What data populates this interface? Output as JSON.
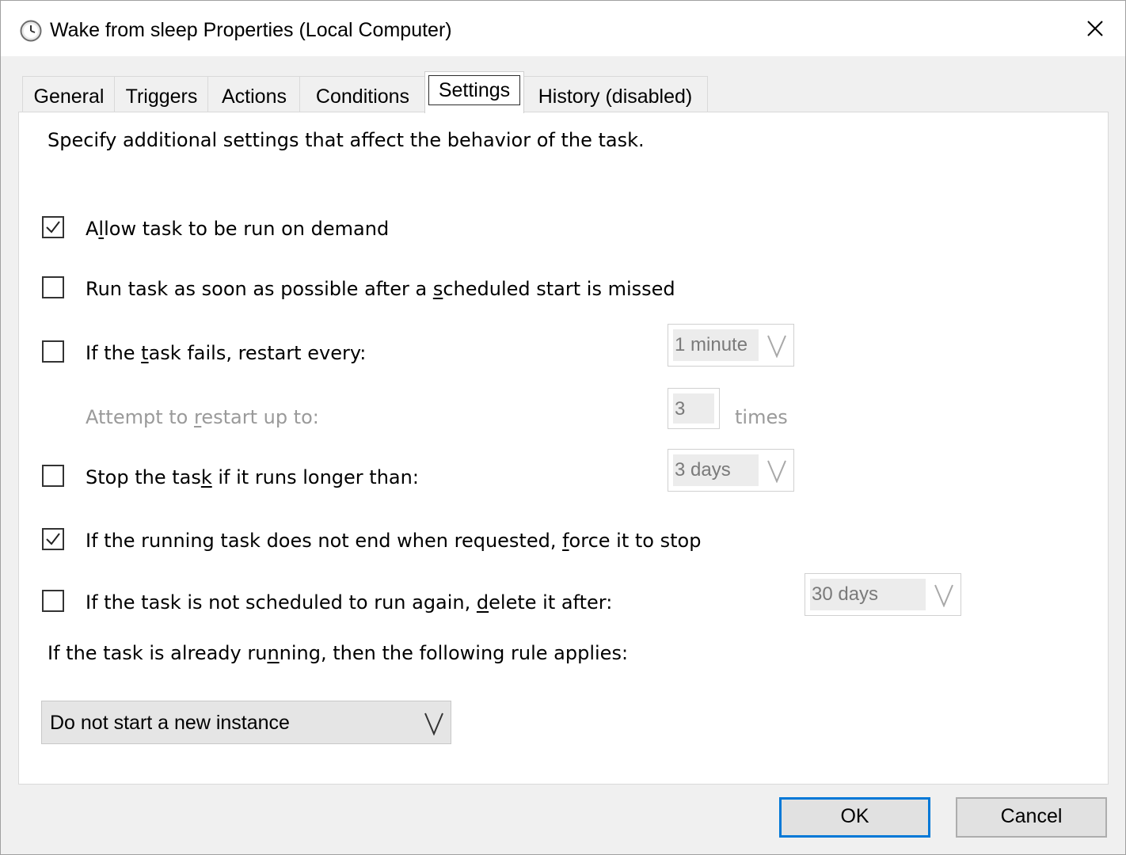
{
  "window": {
    "title": "Wake from sleep Properties (Local Computer)",
    "title_icon": "clock-icon",
    "close_icon": "close-icon"
  },
  "tabs": [
    {
      "label": "General",
      "active": false
    },
    {
      "label": "Triggers",
      "active": false
    },
    {
      "label": "Actions",
      "active": false
    },
    {
      "label": "Conditions",
      "active": false
    },
    {
      "label": "Settings",
      "active": true
    },
    {
      "label": "History (disabled)",
      "active": false
    }
  ],
  "settings": {
    "description": "Specify additional settings that affect the behavior of the task.",
    "allow_on_demand": {
      "label_pre": "A",
      "label_u": "l",
      "label_post": "low task to be run on demand",
      "checked": true
    },
    "run_asap": {
      "label_pre": "Run task as soon as possible after a ",
      "label_u": "s",
      "label_post": "cheduled start is missed",
      "checked": false
    },
    "restart_on_fail": {
      "label_pre": "If the ",
      "label_u": "t",
      "label_post": "ask fails, restart every:",
      "checked": false,
      "interval": "1 minute"
    },
    "restart_attempts": {
      "label_pre": "Attempt to ",
      "label_u": "r",
      "label_post": "estart up to:",
      "value": "3",
      "unit": "times"
    },
    "stop_if_longer": {
      "label_pre": "Stop the tas",
      "label_u": "k",
      "label_post": " if it runs longer than:",
      "checked": false,
      "duration": "3 days"
    },
    "force_stop": {
      "label_pre": "If the running task does not end when requested, ",
      "label_u": "f",
      "label_post": "orce it to stop",
      "checked": true
    },
    "delete_after": {
      "label_pre": "If the task is not scheduled to run again, ",
      "label_u": "d",
      "label_post": "elete it after:",
      "checked": false,
      "duration": "30 days"
    },
    "running_rule": {
      "label_pre": "If the task is already ru",
      "label_u": "n",
      "label_post": "ning, then the following rule applies:",
      "value": "Do not start a new instance"
    }
  },
  "buttons": {
    "ok": "OK",
    "cancel": "Cancel"
  },
  "colors": {
    "accent": "#0078d7",
    "disabled_text": "#9a9a9a"
  }
}
